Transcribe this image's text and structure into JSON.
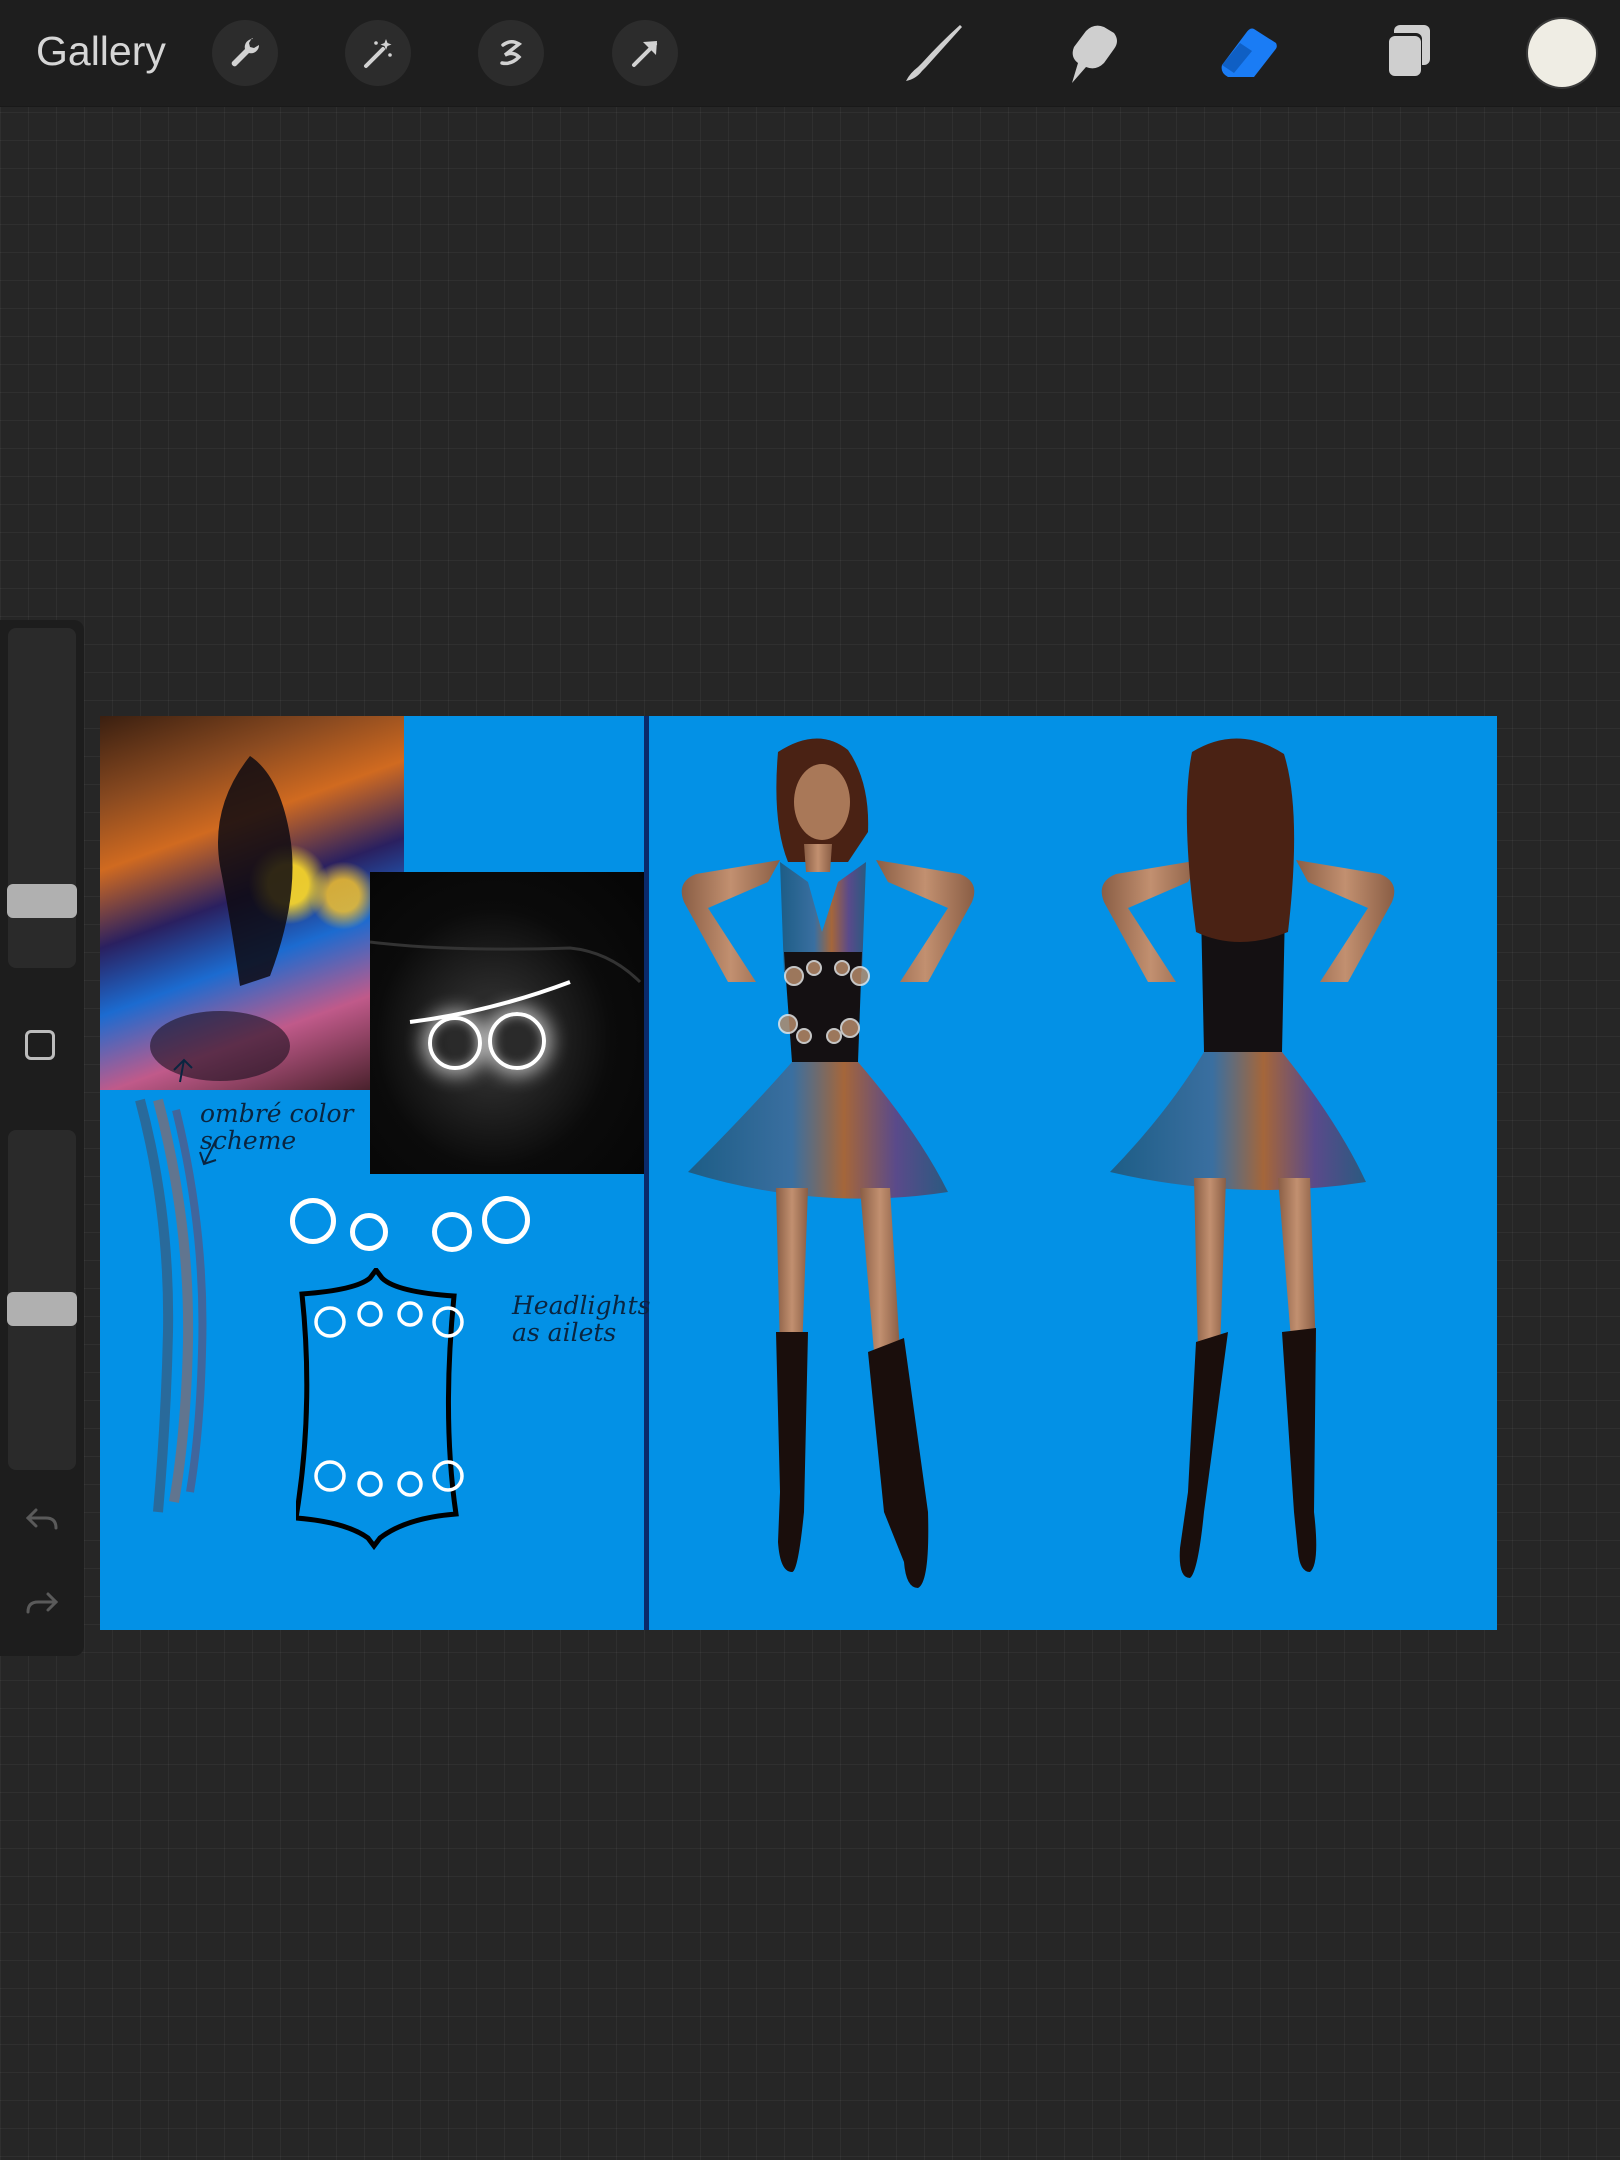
{
  "app": {
    "gallery_label": "Gallery"
  },
  "toolbar": {
    "left_tools": [
      "wrench-icon",
      "magic-wand-icon",
      "selection-icon",
      "transform-arrow-icon"
    ],
    "right_tools": [
      "brush-icon",
      "smudge-icon",
      "eraser-icon",
      "layers-icon"
    ],
    "active_tool": "eraser",
    "accent_color": "#1a7cf5",
    "current_color": "#efede4"
  },
  "sidebar": {
    "brush_size": 0.3,
    "opacity": 0.45
  },
  "canvas": {
    "background_color": "#0391e6",
    "annotations": {
      "ombre": "ombré color\nscheme",
      "headlights": "Headlights\nas ailets"
    }
  }
}
